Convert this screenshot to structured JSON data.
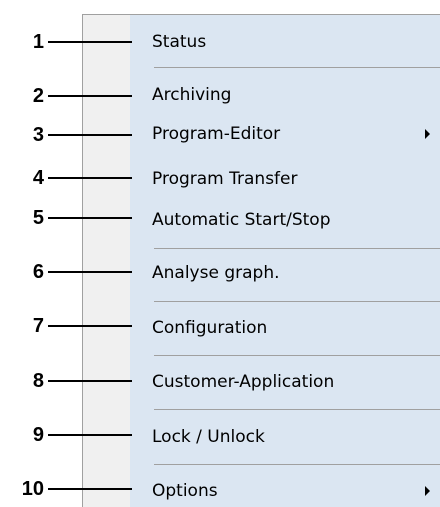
{
  "menu": {
    "items": [
      {
        "number": "1",
        "label": "Status",
        "submenu": false
      },
      {
        "number": "2",
        "label": "Archiving",
        "submenu": false
      },
      {
        "number": "3",
        "label": "Program-Editor",
        "submenu": true
      },
      {
        "number": "4",
        "label": "Program Transfer",
        "submenu": false
      },
      {
        "number": "5",
        "label": "Automatic Start/Stop",
        "submenu": false
      },
      {
        "number": "6",
        "label": "Analyse graph.",
        "submenu": false
      },
      {
        "number": "7",
        "label": "Configuration",
        "submenu": false
      },
      {
        "number": "8",
        "label": "Customer-Application",
        "submenu": false
      },
      {
        "number": "9",
        "label": "Lock / Unlock",
        "submenu": false
      },
      {
        "number": "10",
        "label": "Options",
        "submenu": true
      }
    ]
  },
  "icons": {
    "submenu_arrow": "chevron-right-icon"
  },
  "colors": {
    "menu_body": "#dbe6f2",
    "menu_gutter": "#f0f0f0",
    "separator": "#a0a0a0"
  }
}
